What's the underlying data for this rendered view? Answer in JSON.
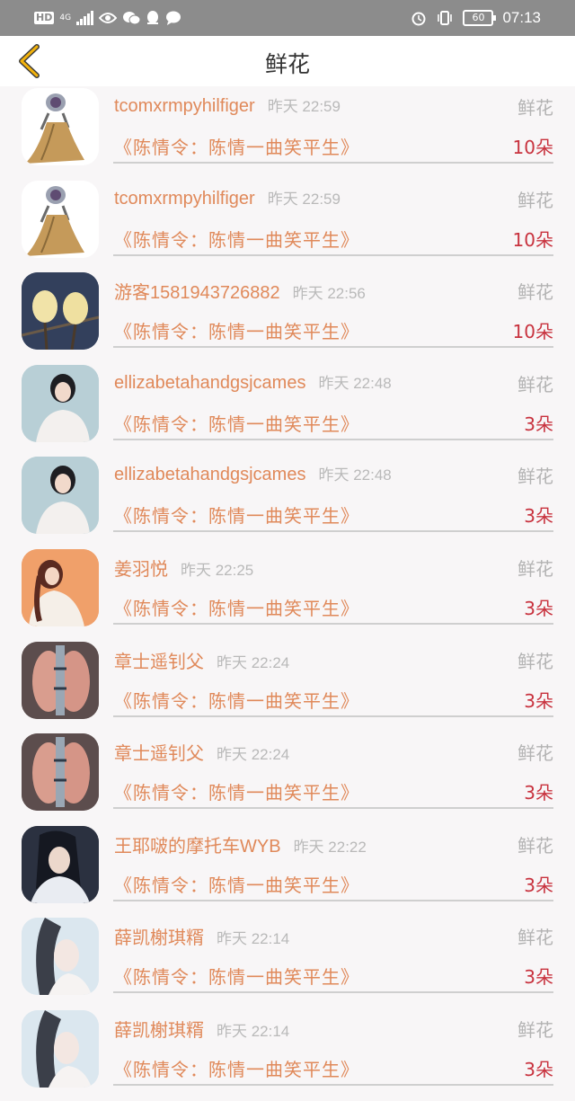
{
  "status_bar": {
    "hd": "HD",
    "network": "4G",
    "battery": "60",
    "time": "07:13"
  },
  "header": {
    "title": "鲜花"
  },
  "colors": {
    "username": "#e0895a",
    "count": "#c8323e",
    "muted": "#b3b3b3",
    "header_back": "#f2b20c"
  },
  "rows": [
    {
      "user": "tcomxrmpyhilfiger",
      "time": "昨天 22:59",
      "type": "鲜花",
      "work": "《陈情令：陈情一曲笑平生》",
      "count": "10朵",
      "avatar": "cartoon-avatar-icon"
    },
    {
      "user": "tcomxrmpyhilfiger",
      "time": "昨天 22:59",
      "type": "鲜花",
      "work": "《陈情令：陈情一曲笑平生》",
      "count": "10朵",
      "avatar": "cartoon-avatar-icon"
    },
    {
      "user": "游客1581943726882",
      "time": "昨天 22:56",
      "type": "鲜花",
      "work": "《陈情令：陈情一曲笑平生》",
      "count": "10朵",
      "avatar": "flower-avatar"
    },
    {
      "user": "ellizabetahandgsjcames",
      "time": "昨天 22:48",
      "type": "鲜花",
      "work": "《陈情令：陈情一曲笑平生》",
      "count": "3朵",
      "avatar": "portrait-avatar"
    },
    {
      "user": "ellizabetahandgsjcames",
      "time": "昨天 22:48",
      "type": "鲜花",
      "work": "《陈情令：陈情一曲笑平生》",
      "count": "3朵",
      "avatar": "portrait-avatar"
    },
    {
      "user": "姜羽悦",
      "time": "昨天 22:25",
      "type": "鲜花",
      "work": "《陈情令：陈情一曲笑平生》",
      "count": "3朵",
      "avatar": "portrait-avatar"
    },
    {
      "user": "章士遥钊父",
      "time": "昨天 22:24",
      "type": "鲜花",
      "work": "《陈情令：陈情一曲笑平生》",
      "count": "3朵",
      "avatar": "hands-avatar"
    },
    {
      "user": "章士遥钊父",
      "time": "昨天 22:24",
      "type": "鲜花",
      "work": "《陈情令：陈情一曲笑平生》",
      "count": "3朵",
      "avatar": "hands-avatar"
    },
    {
      "user": "王耶啵的摩托车WYB",
      "time": "昨天 22:22",
      "type": "鲜花",
      "work": "《陈情令：陈情一曲笑平生》",
      "count": "3朵",
      "avatar": "portrait-avatar"
    },
    {
      "user": "薛凯榭琪糈",
      "time": "昨天 22:14",
      "type": "鲜花",
      "work": "《陈情令：陈情一曲笑平生》",
      "count": "3朵",
      "avatar": "portrait-avatar"
    },
    {
      "user": "薛凯榭琪糈",
      "time": "昨天 22:14",
      "type": "鲜花",
      "work": "《陈情令：陈情一曲笑平生》",
      "count": "3朵",
      "avatar": "portrait-avatar"
    }
  ]
}
